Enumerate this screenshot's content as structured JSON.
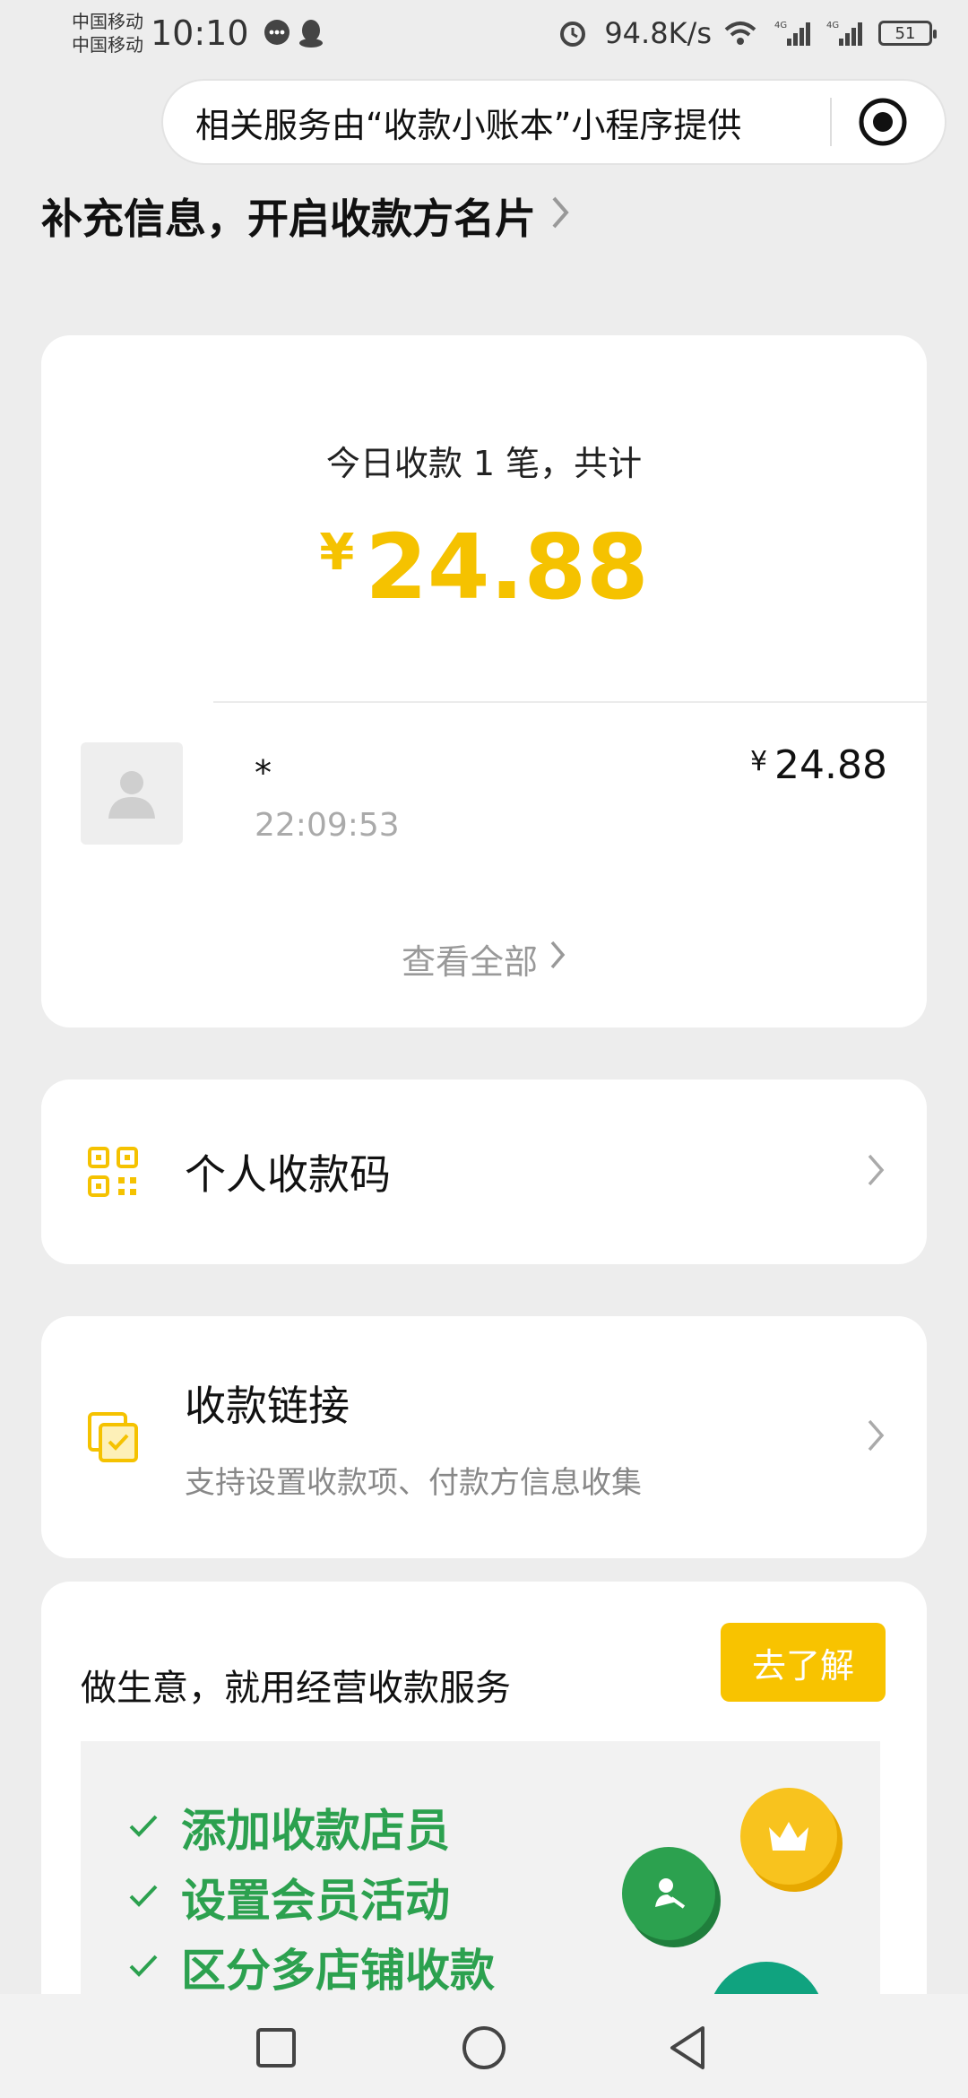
{
  "status_bar": {
    "carrier1": "中国移动",
    "carrier2": "中国移动",
    "time": "10:10",
    "net_speed": "94.8K/s",
    "battery": "51",
    "icons": [
      "message-icon",
      "qq-icon",
      "alarm-icon",
      "wifi-icon",
      "signal-4g-icon",
      "signal-4g-icon"
    ]
  },
  "capsule": {
    "text": "相关服务由“收款小账本”小程序提供",
    "icon": "target-icon"
  },
  "header": {
    "title": "补充信息，开启收款方名片"
  },
  "summary": {
    "title": "今日收款 1 笔，共计",
    "currency": "¥",
    "total": "24.88",
    "transaction": {
      "name": "*",
      "time": "22:09:53",
      "currency": "¥",
      "amount": "24.88"
    },
    "view_all": "查看全部"
  },
  "menu": {
    "qr": {
      "title": "个人收款码",
      "icon": "qr-code-icon"
    },
    "link": {
      "title": "收款链接",
      "subtitle": "支持设置收款项、付款方信息收集",
      "icon": "link-card-icon"
    }
  },
  "promo": {
    "title": "做生意，就用经营收款服务",
    "button": "去了解",
    "features": [
      "添加收款店员",
      "设置会员活动",
      "区分多店铺收款"
    ]
  },
  "colors": {
    "accent_yellow": "#f5c200",
    "button_yellow": "#f8c300",
    "feature_green": "#2ca14f",
    "background": "#ededed"
  }
}
